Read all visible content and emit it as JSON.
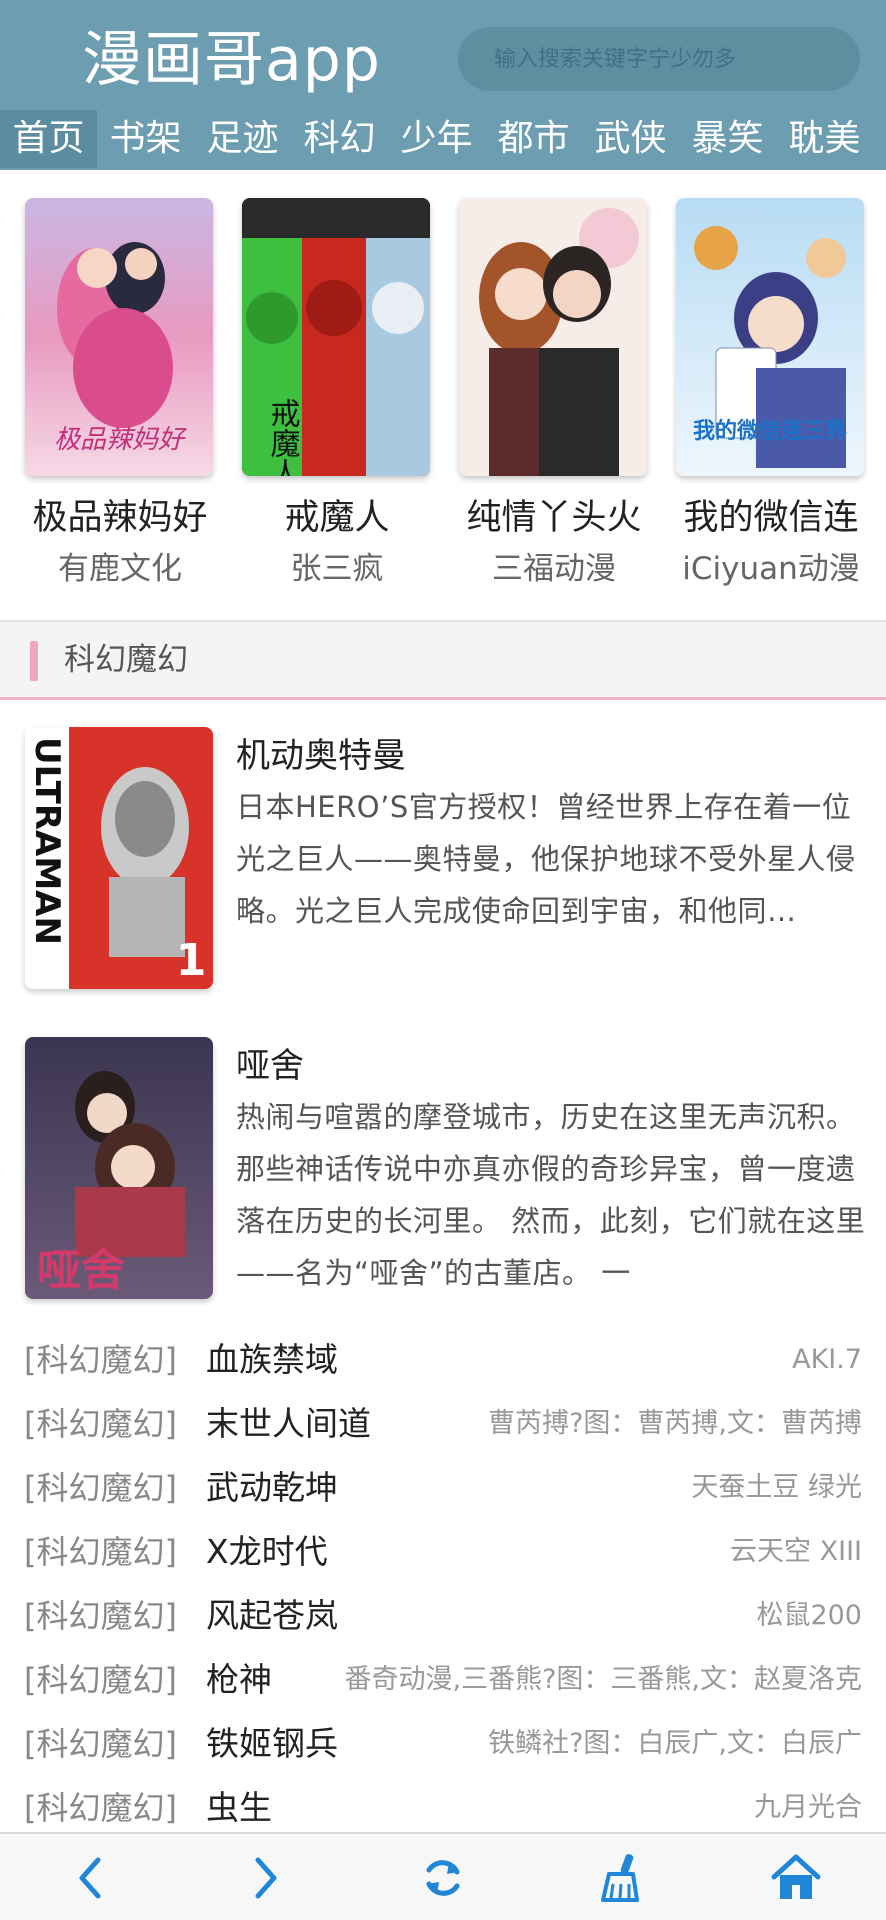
{
  "header": {
    "app_title": "漫画哥app",
    "search_placeholder": "输入搜索关键字宁少勿多"
  },
  "nav_tabs": [
    {
      "label": "首页",
      "active": true
    },
    {
      "label": "书架"
    },
    {
      "label": "足迹"
    },
    {
      "label": "科幻"
    },
    {
      "label": "少年"
    },
    {
      "label": "都市"
    },
    {
      "label": "武侠"
    },
    {
      "label": "暴笑"
    },
    {
      "label": "耽美"
    }
  ],
  "featured": [
    {
      "title": "极品辣妈好",
      "author": "有鹿文化",
      "cover_text": "极品辣妈好"
    },
    {
      "title": "戒魔人",
      "author": "张三疯",
      "cover_text": "戒魔人"
    },
    {
      "title": "纯情丫头火",
      "author": "三福动漫",
      "cover_text": ""
    },
    {
      "title": "我的微信连",
      "author": "iCiyuan动漫",
      "cover_text": "我的微信连三界"
    }
  ],
  "section": {
    "title": "科幻魔幻"
  },
  "books": [
    {
      "title": "机动奥特曼",
      "description": "日本HERO’S官方授权！曾经世界上存在着一位光之巨人——奥特曼，他保护地球不受外星人侵略。光之巨人完成使命回到宇宙，和他同…",
      "cover_text": "ULTRAMAN",
      "cover_badge": "1"
    },
    {
      "title": "哑舍",
      "description": "热闹与喧嚣的摩登城市，历史在这里无声沉积。 那些神话传说中亦真亦假的奇珍异宝，曾一度遗落在历史的长河里。 然而，此刻，它们就在这里——名为“哑舍”的古董店。 一",
      "cover_text": "哑舍"
    }
  ],
  "list": [
    {
      "category": "[科幻魔幻]",
      "title": "血族禁域",
      "author": "AKI.7"
    },
    {
      "category": "[科幻魔幻]",
      "title": "末世人间道",
      "author": "曹芮搏?图：曹芮搏,文：曹芮搏"
    },
    {
      "category": "[科幻魔幻]",
      "title": "武动乾坤",
      "author": "天蚕土豆 绿光"
    },
    {
      "category": "[科幻魔幻]",
      "title": "X龙时代",
      "author": "云天空 XIII"
    },
    {
      "category": "[科幻魔幻]",
      "title": "风起苍岚",
      "author": "松鼠200"
    },
    {
      "category": "[科幻魔幻]",
      "title": "枪神",
      "author": "番奇动漫,三番熊?图：三番熊,文：赵夏洛克"
    },
    {
      "category": "[科幻魔幻]",
      "title": "铁姬钢兵",
      "author": "铁鳞社?图：白辰广,文：白辰广"
    },
    {
      "category": "[科幻魔幻]",
      "title": "虫生",
      "author": "九月光合"
    }
  ],
  "bottom_bar": [
    {
      "icon": "back-arrow-icon"
    },
    {
      "icon": "forward-arrow-icon"
    },
    {
      "icon": "refresh-icon"
    },
    {
      "icon": "broom-icon"
    },
    {
      "icon": "home-icon"
    }
  ],
  "colors": {
    "header_bg": "#6d9db0",
    "accent_pink": "#f1a6bc",
    "icon_blue": "#1f86d8"
  }
}
